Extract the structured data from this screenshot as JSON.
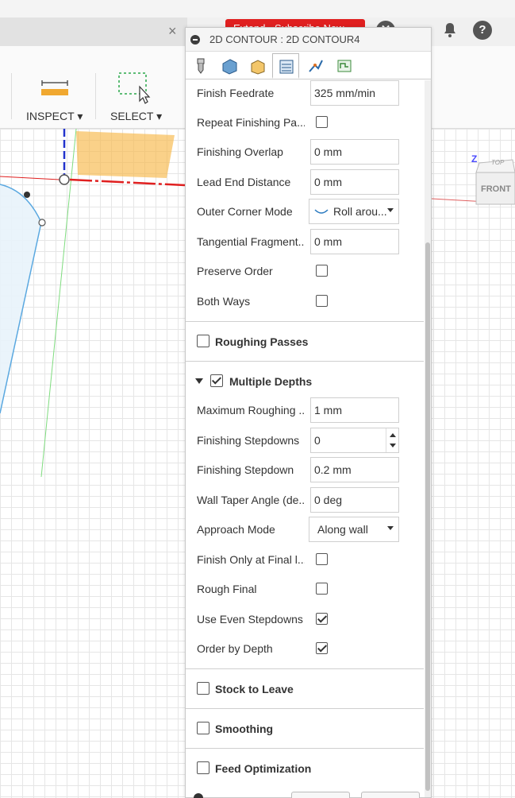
{
  "header": {
    "doc_close": "×",
    "red_button_label": "Extend · Subscribe Now",
    "icons": [
      "avatar-icon",
      "bell-icon",
      "help-icon"
    ],
    "help_glyph": "?",
    "accent_red": "#e02020"
  },
  "toolbar": {
    "inspect_label": "INSPECT ▾",
    "select_label": "SELECT ▾"
  },
  "viewcube": {
    "top": "TOP",
    "front": "FRONT",
    "axis": "Z"
  },
  "panel": {
    "title": "2D CONTOUR : 2D CONTOUR4",
    "tabs": [
      "tool-tab",
      "geometry-tab",
      "heights-tab",
      "passes-tab",
      "linking-tab",
      "post-tab"
    ],
    "active_tab": "passes-tab",
    "rows_top": [
      {
        "label": "Finish Feedrate",
        "type": "input",
        "value": "325 mm/min"
      },
      {
        "label": "Repeat Finishing Pa...",
        "type": "checkbox",
        "checked": false
      },
      {
        "label": "Finishing Overlap",
        "type": "input",
        "value": "0 mm"
      },
      {
        "label": "Lead End Distance",
        "type": "input",
        "value": "0 mm"
      },
      {
        "label": "Outer Corner Mode",
        "type": "select",
        "value": "Roll arou..."
      },
      {
        "label": "Tangential Fragment...",
        "type": "input",
        "value": "0 mm"
      },
      {
        "label": "Preserve Order",
        "type": "checkbox",
        "checked": false
      },
      {
        "label": "Both Ways",
        "type": "checkbox",
        "checked": false
      }
    ],
    "roughing_passes": {
      "title": "Roughing Passes",
      "checked": false
    },
    "multiple_depths": {
      "title": "Multiple Depths",
      "checked": true,
      "expanded": true
    },
    "rows_depths": [
      {
        "label": "Maximum Roughing ...",
        "type": "input",
        "value": "1 mm"
      },
      {
        "label": "Finishing Stepdowns",
        "type": "spinner",
        "value": "0"
      },
      {
        "label": "Finishing Stepdown",
        "type": "input",
        "value": "0.2 mm"
      },
      {
        "label": "Wall Taper Angle (de...",
        "type": "input",
        "value": "0 deg"
      },
      {
        "label": "Approach Mode",
        "type": "select",
        "value": "Along wall"
      },
      {
        "label": "Finish Only at Final l...",
        "type": "checkbox",
        "checked": false
      },
      {
        "label": "Rough Final",
        "type": "checkbox",
        "checked": false
      },
      {
        "label": "Use Even Stepdowns",
        "type": "checkbox",
        "checked": true
      },
      {
        "label": "Order by Depth",
        "type": "checkbox",
        "checked": true
      }
    ],
    "stock_to_leave": {
      "title": "Stock to Leave",
      "checked": false
    },
    "smoothing": {
      "title": "Smoothing",
      "checked": false
    },
    "feed_optimization": {
      "title": "Feed Optimization",
      "checked": false
    }
  }
}
